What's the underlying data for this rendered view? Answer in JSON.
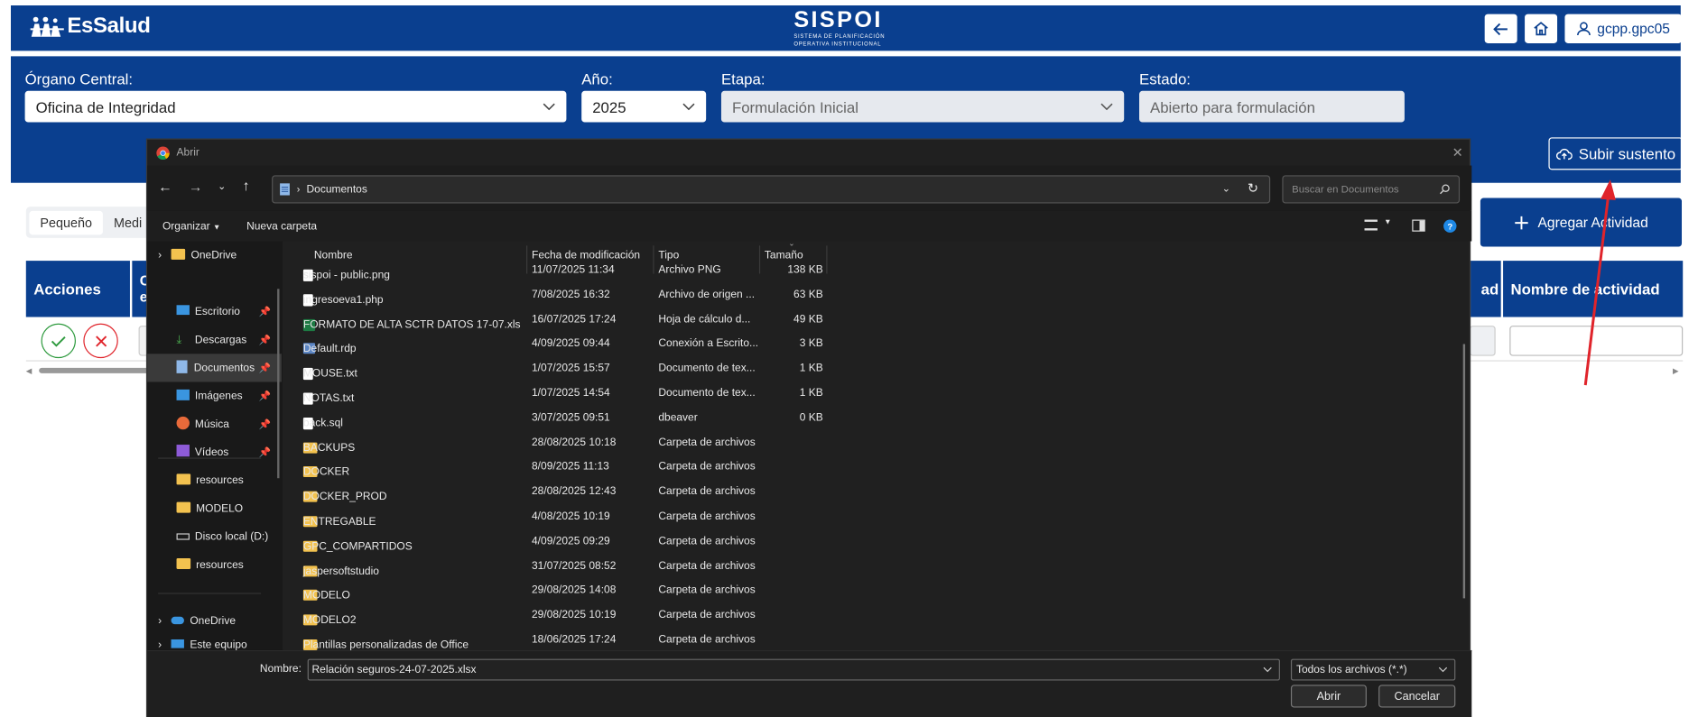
{
  "header": {
    "brand": "EsSalud",
    "app_name": "SISPOI",
    "app_tagline_1": "SISTEMA DE PLANIFICACIÓN",
    "app_tagline_2": "OPERATIVA INSTITUCIONAL",
    "user": "gcpp.gpc05"
  },
  "filters": {
    "organo_label": "Órgano Central:",
    "organo_value": "Oficina de Integridad",
    "anio_label": "Año:",
    "anio_value": "2025",
    "etapa_label": "Etapa:",
    "etapa_value": "Formulación Inicial",
    "estado_label": "Estado:",
    "estado_value": "Abierto para formulación",
    "subir_label": "Subir sustento"
  },
  "content": {
    "size_tabs": [
      "Pequeño",
      "Medi"
    ],
    "agregar_label": "Agregar Actividad",
    "col_acciones": "Acciones",
    "col_partial_left": "C",
    "col_partial_left2": "e",
    "col_partial_right": "ad",
    "col_nombre": "Nombre de actividad"
  },
  "dialog": {
    "title": "Abrir",
    "breadcrumb": "Documentos",
    "search_placeholder": "Buscar en Documentos",
    "organizar": "Organizar",
    "nueva_carpeta": "Nueva carpeta",
    "columns": {
      "nombre": "Nombre",
      "fecha": "Fecha de modificación",
      "tipo": "Tipo",
      "tamano": "Tamaño"
    },
    "sidebar": [
      {
        "label": "OneDrive",
        "icon": "folder-icon",
        "expander": true
      },
      {
        "label": "Escritorio",
        "icon": "desktop-icon",
        "pinned": true
      },
      {
        "label": "Descargas",
        "icon": "download-icon",
        "pinned": true
      },
      {
        "label": "Documentos",
        "icon": "document-icon",
        "pinned": true,
        "selected": true
      },
      {
        "label": "Imágenes",
        "icon": "image-icon",
        "pinned": true
      },
      {
        "label": "Música",
        "icon": "music-icon",
        "pinned": true
      },
      {
        "label": "Vídeos",
        "icon": "video-icon",
        "pinned": true
      },
      {
        "label": "resources",
        "icon": "folder-icon"
      },
      {
        "label": "MODELO",
        "icon": "folder-icon"
      },
      {
        "label": "Disco local (D:)",
        "icon": "drive-icon"
      },
      {
        "label": "resources",
        "icon": "folder-icon"
      },
      {
        "label": "OneDrive",
        "icon": "cloud-icon",
        "expander": true
      },
      {
        "label": "Este equipo",
        "icon": "computer-icon",
        "expander": true
      }
    ],
    "files": [
      {
        "name": "sispoi - public.png",
        "date": "11/07/2025 11:34",
        "type": "Archivo PNG",
        "size": "138 KB",
        "kind": "file"
      },
      {
        "name": "ingresoeva1.php",
        "date": "7/08/2025 16:32",
        "type": "Archivo de origen ...",
        "size": "63 KB",
        "kind": "file"
      },
      {
        "name": "FORMATO DE ALTA SCTR DATOS 17-07.xls",
        "date": "16/07/2025 17:24",
        "type": "Hoja de cálculo d...",
        "size": "49 KB",
        "kind": "excel"
      },
      {
        "name": "Default.rdp",
        "date": "4/09/2025 09:44",
        "type": "Conexión a Escrito...",
        "size": "3 KB",
        "kind": "rdp"
      },
      {
        "name": "MOUSE.txt",
        "date": "1/07/2025 15:57",
        "type": "Documento de tex...",
        "size": "1 KB",
        "kind": "file"
      },
      {
        "name": "NOTAS.txt",
        "date": "1/07/2025 14:54",
        "type": "Documento de tex...",
        "size": "1 KB",
        "kind": "file"
      },
      {
        "name": "back.sql",
        "date": "3/07/2025 09:51",
        "type": "dbeaver",
        "size": "0 KB",
        "kind": "file"
      },
      {
        "name": "BACKUPS",
        "date": "28/08/2025 10:18",
        "type": "Carpeta de archivos",
        "size": "",
        "kind": "folder"
      },
      {
        "name": "DOCKER",
        "date": "8/09/2025 11:13",
        "type": "Carpeta de archivos",
        "size": "",
        "kind": "folder"
      },
      {
        "name": "DOCKER_PROD",
        "date": "28/08/2025 12:43",
        "type": "Carpeta de archivos",
        "size": "",
        "kind": "folder"
      },
      {
        "name": "ENTREGABLE",
        "date": "4/08/2025 10:19",
        "type": "Carpeta de archivos",
        "size": "",
        "kind": "folder"
      },
      {
        "name": "GPC_COMPARTIDOS",
        "date": "4/09/2025 09:29",
        "type": "Carpeta de archivos",
        "size": "",
        "kind": "folder"
      },
      {
        "name": "jaspersoftstudio",
        "date": "31/07/2025 08:52",
        "type": "Carpeta de archivos",
        "size": "",
        "kind": "folder"
      },
      {
        "name": "MODELO",
        "date": "29/08/2025 14:08",
        "type": "Carpeta de archivos",
        "size": "",
        "kind": "folder"
      },
      {
        "name": "MODELO2",
        "date": "29/08/2025 10:19",
        "type": "Carpeta de archivos",
        "size": "",
        "kind": "folder"
      },
      {
        "name": "Plantillas personalizadas de Office",
        "date": "18/06/2025 17:24",
        "type": "Carpeta de archivos",
        "size": "",
        "kind": "folder"
      }
    ],
    "nombre_label": "Nombre:",
    "nombre_value": "Relación seguros-24-07-2025.xlsx",
    "tipo_value": "Todos los archivos (*.*)",
    "abrir_label": "Abrir",
    "cancelar_label": "Cancelar"
  },
  "colors": {
    "primary": "#0a3f8f",
    "accent_red": "#e0242b",
    "ok_green": "#2e9a3e"
  }
}
